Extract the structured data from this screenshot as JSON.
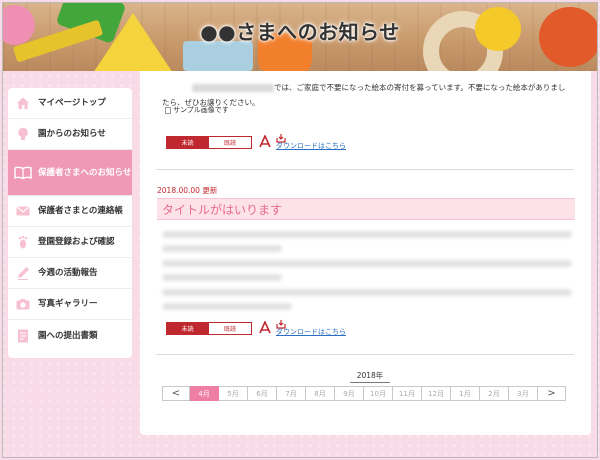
{
  "header": {
    "title": "●●さまへのお知らせ"
  },
  "sidebar": {
    "items": [
      {
        "label": "マイページトップ",
        "icon": "home-icon"
      },
      {
        "label": "園からのお知らせ",
        "icon": "lightbulb-icon"
      },
      {
        "label": "保護者さまへのお知らせ",
        "icon": "book-icon"
      },
      {
        "label": "保護者さまとの連絡帳",
        "icon": "envelope-icon"
      },
      {
        "label": "登園登録および確認",
        "icon": "footprint-icon"
      },
      {
        "label": "今週の活動報告",
        "icon": "pencil-icon"
      },
      {
        "label": "写真ギャラリー",
        "icon": "camera-icon"
      },
      {
        "label": "園への提出書類",
        "icon": "document-icon"
      }
    ],
    "active_index": 2
  },
  "notices": [
    {
      "body_line1_suffix": "では、ご家庭で不要になった絵本の寄付を募っています。不要になった絵本がありまし",
      "body_line2": "たら、ぜひお譲りください。",
      "image_alt": "サンプル画像です",
      "unread_label": "未読",
      "read_label": "既読",
      "download_label": "ダウンロードはこちら"
    },
    {
      "date": "2018.00.00 更新",
      "title": "タイトルがはいります",
      "unread_label": "未読",
      "read_label": "既読",
      "download_label": "ダウンロードはこちら"
    }
  ],
  "pager": {
    "year": "2018年",
    "prev": "<",
    "next": ">",
    "months": [
      "4月",
      "5月",
      "6月",
      "7月",
      "8月",
      "9月",
      "10月",
      "11月",
      "12月",
      "1月",
      "2月",
      "3月"
    ],
    "active_month": "4月"
  },
  "colors": {
    "accent_pink": "#ef99b6",
    "title_pink": "#e86a91",
    "status_red": "#c0282f",
    "link_blue": "#2a6fc0"
  }
}
